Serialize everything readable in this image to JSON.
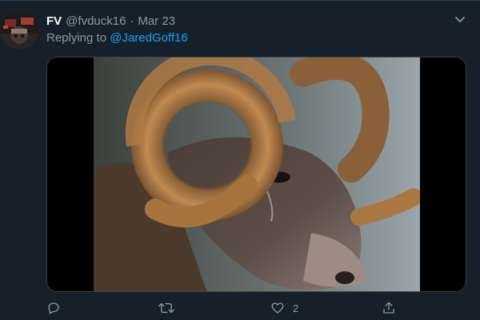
{
  "tweet": {
    "display_name": "FV",
    "handle": "@fvduck16",
    "separator": "·",
    "date": "Mar 23",
    "replying_prefix": "Replying to",
    "replying_to": "@JaredGoff16",
    "media": {
      "description_icon": "ram-photo"
    },
    "actions": {
      "reply": {
        "icon": "reply-icon",
        "count": ""
      },
      "retweet": {
        "icon": "retweet-icon",
        "count": ""
      },
      "like": {
        "icon": "heart-icon",
        "count": "2"
      },
      "share": {
        "icon": "share-icon",
        "count": ""
      }
    }
  },
  "colors": {
    "background": "#15202b",
    "secondary_text": "#8899a6",
    "link": "#1da1f2"
  }
}
